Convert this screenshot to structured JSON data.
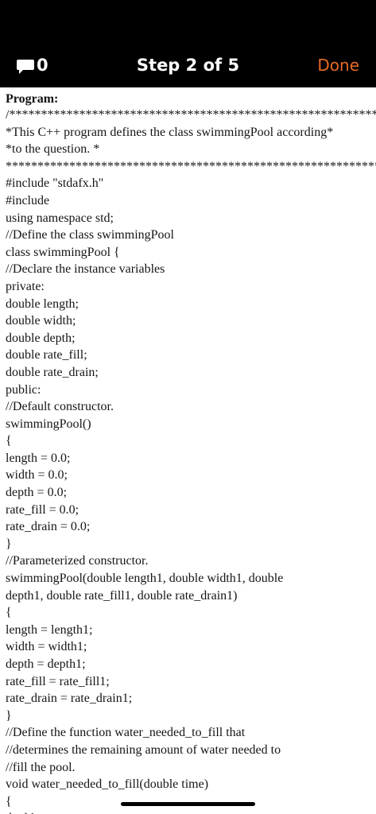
{
  "header": {
    "comment_count": "0",
    "title": "Step 2 of 5",
    "done_label": "Done",
    "comment_icon": "speech-bubble-icon",
    "accent_color": "#e86a24",
    "background_color": "#000000"
  },
  "content": {
    "heading": "Program:",
    "lines": [
      "/**********************************************************************",
      "*This C++ program defines the class swimmingPool according*",
      "*to the question. *",
      "**********************************************************************",
      "#include \"stdafx.h\"",
      "#include",
      "using namespace std;",
      "//Define the class swimmingPool",
      "class swimmingPool {",
      "//Declare the instance variables",
      "private:",
      "double length;",
      "double width;",
      "double depth;",
      "double rate_fill;",
      "double rate_drain;",
      "public:",
      "//Default constructor.",
      "swimmingPool()",
      "{",
      "length = 0.0;",
      "width = 0.0;",
      "depth = 0.0;",
      "rate_fill = 0.0;",
      "rate_drain = 0.0;",
      "}",
      "//Parameterized constructor.",
      "swimmingPool(double length1, double width1, double",
      "depth1, double rate_fill1, double rate_drain1)",
      "{",
      "length = length1;",
      "width = width1;",
      "depth = depth1;",
      "rate_fill = rate_fill1;",
      "rate_drain = rate_drain1;",
      "}",
      "//Define the function water_needed_to_fill that",
      "//determines the remaining amount of water needed to",
      "//fill the pool.",
      "void water_needed_to_fill(double time)",
      "{",
      "double"
    ]
  }
}
